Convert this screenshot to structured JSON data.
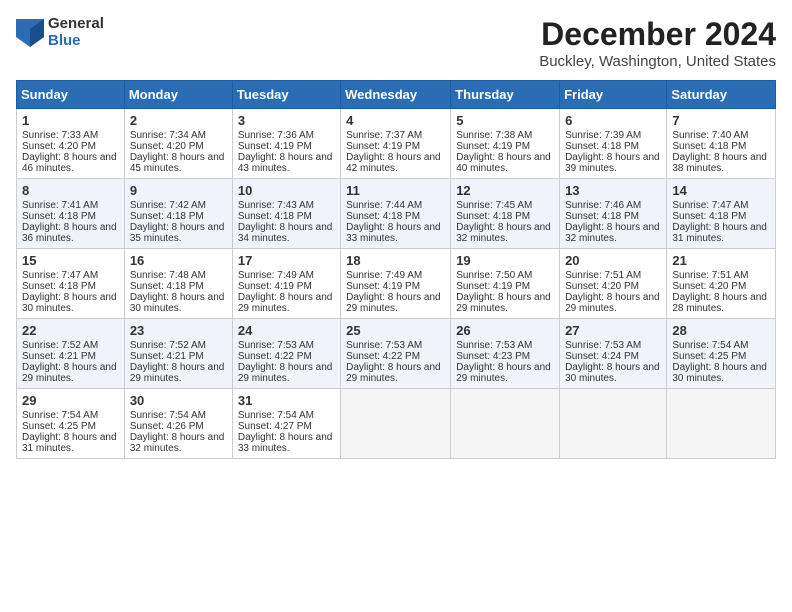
{
  "logo": {
    "general": "General",
    "blue": "Blue"
  },
  "title": "December 2024",
  "location": "Buckley, Washington, United States",
  "days_of_week": [
    "Sunday",
    "Monday",
    "Tuesday",
    "Wednesday",
    "Thursday",
    "Friday",
    "Saturday"
  ],
  "weeks": [
    [
      {
        "day": "1",
        "sunrise": "Sunrise: 7:33 AM",
        "sunset": "Sunset: 4:20 PM",
        "daylight": "Daylight: 8 hours and 46 minutes."
      },
      {
        "day": "2",
        "sunrise": "Sunrise: 7:34 AM",
        "sunset": "Sunset: 4:20 PM",
        "daylight": "Daylight: 8 hours and 45 minutes."
      },
      {
        "day": "3",
        "sunrise": "Sunrise: 7:36 AM",
        "sunset": "Sunset: 4:19 PM",
        "daylight": "Daylight: 8 hours and 43 minutes."
      },
      {
        "day": "4",
        "sunrise": "Sunrise: 7:37 AM",
        "sunset": "Sunset: 4:19 PM",
        "daylight": "Daylight: 8 hours and 42 minutes."
      },
      {
        "day": "5",
        "sunrise": "Sunrise: 7:38 AM",
        "sunset": "Sunset: 4:19 PM",
        "daylight": "Daylight: 8 hours and 40 minutes."
      },
      {
        "day": "6",
        "sunrise": "Sunrise: 7:39 AM",
        "sunset": "Sunset: 4:18 PM",
        "daylight": "Daylight: 8 hours and 39 minutes."
      },
      {
        "day": "7",
        "sunrise": "Sunrise: 7:40 AM",
        "sunset": "Sunset: 4:18 PM",
        "daylight": "Daylight: 8 hours and 38 minutes."
      }
    ],
    [
      {
        "day": "8",
        "sunrise": "Sunrise: 7:41 AM",
        "sunset": "Sunset: 4:18 PM",
        "daylight": "Daylight: 8 hours and 36 minutes."
      },
      {
        "day": "9",
        "sunrise": "Sunrise: 7:42 AM",
        "sunset": "Sunset: 4:18 PM",
        "daylight": "Daylight: 8 hours and 35 minutes."
      },
      {
        "day": "10",
        "sunrise": "Sunrise: 7:43 AM",
        "sunset": "Sunset: 4:18 PM",
        "daylight": "Daylight: 8 hours and 34 minutes."
      },
      {
        "day": "11",
        "sunrise": "Sunrise: 7:44 AM",
        "sunset": "Sunset: 4:18 PM",
        "daylight": "Daylight: 8 hours and 33 minutes."
      },
      {
        "day": "12",
        "sunrise": "Sunrise: 7:45 AM",
        "sunset": "Sunset: 4:18 PM",
        "daylight": "Daylight: 8 hours and 32 minutes."
      },
      {
        "day": "13",
        "sunrise": "Sunrise: 7:46 AM",
        "sunset": "Sunset: 4:18 PM",
        "daylight": "Daylight: 8 hours and 32 minutes."
      },
      {
        "day": "14",
        "sunrise": "Sunrise: 7:47 AM",
        "sunset": "Sunset: 4:18 PM",
        "daylight": "Daylight: 8 hours and 31 minutes."
      }
    ],
    [
      {
        "day": "15",
        "sunrise": "Sunrise: 7:47 AM",
        "sunset": "Sunset: 4:18 PM",
        "daylight": "Daylight: 8 hours and 30 minutes."
      },
      {
        "day": "16",
        "sunrise": "Sunrise: 7:48 AM",
        "sunset": "Sunset: 4:18 PM",
        "daylight": "Daylight: 8 hours and 30 minutes."
      },
      {
        "day": "17",
        "sunrise": "Sunrise: 7:49 AM",
        "sunset": "Sunset: 4:19 PM",
        "daylight": "Daylight: 8 hours and 29 minutes."
      },
      {
        "day": "18",
        "sunrise": "Sunrise: 7:49 AM",
        "sunset": "Sunset: 4:19 PM",
        "daylight": "Daylight: 8 hours and 29 minutes."
      },
      {
        "day": "19",
        "sunrise": "Sunrise: 7:50 AM",
        "sunset": "Sunset: 4:19 PM",
        "daylight": "Daylight: 8 hours and 29 minutes."
      },
      {
        "day": "20",
        "sunrise": "Sunrise: 7:51 AM",
        "sunset": "Sunset: 4:20 PM",
        "daylight": "Daylight: 8 hours and 29 minutes."
      },
      {
        "day": "21",
        "sunrise": "Sunrise: 7:51 AM",
        "sunset": "Sunset: 4:20 PM",
        "daylight": "Daylight: 8 hours and 28 minutes."
      }
    ],
    [
      {
        "day": "22",
        "sunrise": "Sunrise: 7:52 AM",
        "sunset": "Sunset: 4:21 PM",
        "daylight": "Daylight: 8 hours and 29 minutes."
      },
      {
        "day": "23",
        "sunrise": "Sunrise: 7:52 AM",
        "sunset": "Sunset: 4:21 PM",
        "daylight": "Daylight: 8 hours and 29 minutes."
      },
      {
        "day": "24",
        "sunrise": "Sunrise: 7:53 AM",
        "sunset": "Sunset: 4:22 PM",
        "daylight": "Daylight: 8 hours and 29 minutes."
      },
      {
        "day": "25",
        "sunrise": "Sunrise: 7:53 AM",
        "sunset": "Sunset: 4:22 PM",
        "daylight": "Daylight: 8 hours and 29 minutes."
      },
      {
        "day": "26",
        "sunrise": "Sunrise: 7:53 AM",
        "sunset": "Sunset: 4:23 PM",
        "daylight": "Daylight: 8 hours and 29 minutes."
      },
      {
        "day": "27",
        "sunrise": "Sunrise: 7:53 AM",
        "sunset": "Sunset: 4:24 PM",
        "daylight": "Daylight: 8 hours and 30 minutes."
      },
      {
        "day": "28",
        "sunrise": "Sunrise: 7:54 AM",
        "sunset": "Sunset: 4:25 PM",
        "daylight": "Daylight: 8 hours and 30 minutes."
      }
    ],
    [
      {
        "day": "29",
        "sunrise": "Sunrise: 7:54 AM",
        "sunset": "Sunset: 4:25 PM",
        "daylight": "Daylight: 8 hours and 31 minutes."
      },
      {
        "day": "30",
        "sunrise": "Sunrise: 7:54 AM",
        "sunset": "Sunset: 4:26 PM",
        "daylight": "Daylight: 8 hours and 32 minutes."
      },
      {
        "day": "31",
        "sunrise": "Sunrise: 7:54 AM",
        "sunset": "Sunset: 4:27 PM",
        "daylight": "Daylight: 8 hours and 33 minutes."
      },
      null,
      null,
      null,
      null
    ]
  ]
}
